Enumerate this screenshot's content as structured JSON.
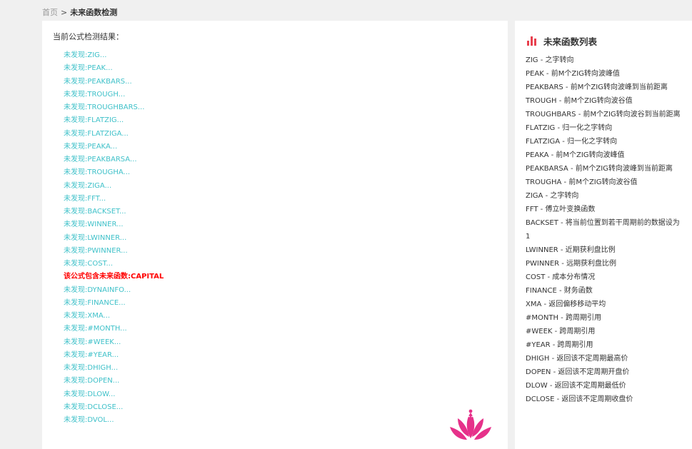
{
  "breadcrumb": {
    "home": "首页",
    "separator": ">",
    "current": "未来函数检测"
  },
  "result": {
    "heading": "当前公式检测结果：",
    "items": [
      {
        "text": "未发现:ZIG...",
        "found": false
      },
      {
        "text": "未发现:PEAK...",
        "found": false
      },
      {
        "text": "未发现:PEAKBARS...",
        "found": false
      },
      {
        "text": "未发现:TROUGH...",
        "found": false
      },
      {
        "text": "未发现:TROUGHBARS...",
        "found": false
      },
      {
        "text": "未发现:FLATZIG...",
        "found": false
      },
      {
        "text": "未发现:FLATZIGA...",
        "found": false
      },
      {
        "text": "未发现:PEAKA...",
        "found": false
      },
      {
        "text": "未发现:PEAKBARSA...",
        "found": false
      },
      {
        "text": "未发现:TROUGHA...",
        "found": false
      },
      {
        "text": "未发现:ZIGA...",
        "found": false
      },
      {
        "text": "未发现:FFT...",
        "found": false
      },
      {
        "text": "未发现:BACKSET...",
        "found": false
      },
      {
        "text": "未发现:WINNER...",
        "found": false
      },
      {
        "text": "未发现:LWINNER...",
        "found": false
      },
      {
        "text": "未发现:PWINNER...",
        "found": false
      },
      {
        "text": "未发现:COST...",
        "found": false
      },
      {
        "text": "该公式包含未来函数:CAPITAL",
        "found": true
      },
      {
        "text": "未发现:DYNAINFO...",
        "found": false
      },
      {
        "text": "未发现:FINANCE...",
        "found": false
      },
      {
        "text": "未发现:XMA...",
        "found": false
      },
      {
        "text": "未发现:#MONTH...",
        "found": false
      },
      {
        "text": "未发现:#WEEK...",
        "found": false
      },
      {
        "text": "未发现:#YEAR...",
        "found": false
      },
      {
        "text": "未发现:DHIGH...",
        "found": false
      },
      {
        "text": "未发现:DOPEN...",
        "found": false
      },
      {
        "text": "未发现:DLOW...",
        "found": false
      },
      {
        "text": "未发现:DCLOSE...",
        "found": false
      },
      {
        "text": "未发现:DVOL...",
        "found": false
      }
    ]
  },
  "sidebar": {
    "title": "未来函数列表",
    "icon": "bar-chart-icon",
    "items": [
      "ZIG - 之字转向",
      "PEAK - 前M个ZIG转向波峰值",
      "PEAKBARS - 前M个ZIG转向波峰到当前距离",
      "TROUGH - 前M个ZIG转向波谷值",
      "TROUGHBARS - 前M个ZIG转向波谷到当前距离",
      "FLATZIG - 归一化之字转向",
      "FLATZIGA - 归一化之字转向",
      "PEAKA - 前M个ZIG转向波峰值",
      "PEAKBARSA - 前M个ZIG转向波峰到当前距离",
      "TROUGHA - 前M个ZIG转向波谷值",
      "ZIGA - 之字转向",
      "FFT - 傅立叶变换函数",
      "BACKSET - 将当前位置到若干周期前的数据设为1",
      "LWINNER - 近期获利盘比例",
      "PWINNER - 远期获利盘比例",
      "COST - 成本分布情况",
      "FINANCE - 财务函数",
      "XMA - 返回偏移移动平均",
      "#MONTH - 跨周期引用",
      "#WEEK - 跨周期引用",
      "#YEAR - 跨周期引用",
      "DHIGH - 返回该不定周期最高价",
      "DOPEN - 返回该不定周期开盘价",
      "DLOW - 返回该不定周期最低价",
      "DCLOSE - 返回该不定周期收盘价"
    ]
  },
  "colors": {
    "not_found": "#3fc1c9",
    "found": "#ff0000",
    "accent": "#e8414f",
    "logo": "#e6318a"
  }
}
